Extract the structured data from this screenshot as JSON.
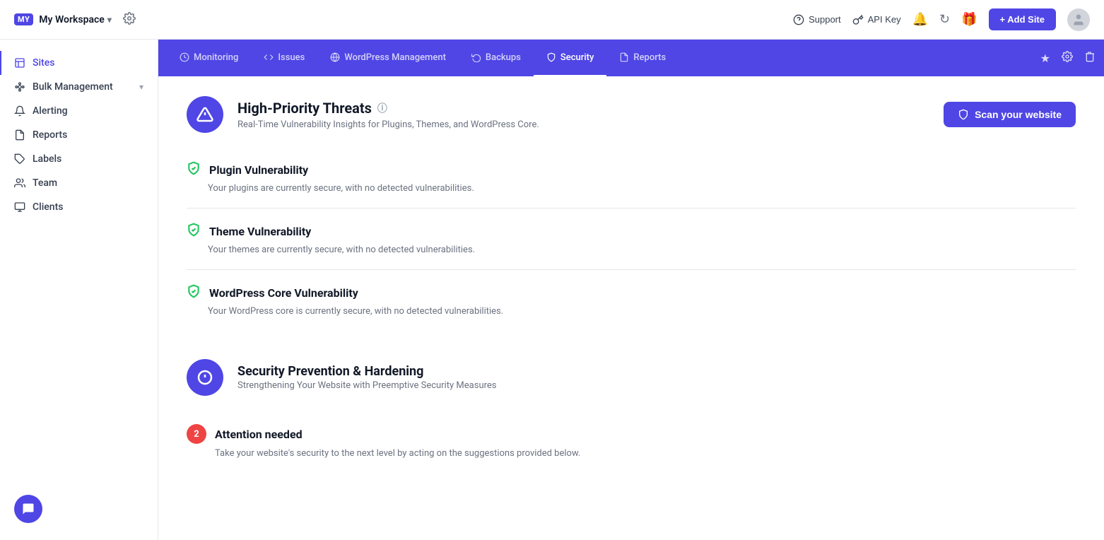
{
  "workspace": {
    "badge": "MY",
    "name": "My Workspace"
  },
  "header": {
    "support_label": "Support",
    "api_key_label": "API Key",
    "add_site_label": "+ Add Site"
  },
  "sidebar": {
    "items": [
      {
        "id": "sites",
        "label": "Sites",
        "active": true
      },
      {
        "id": "bulk-management",
        "label": "Bulk Management",
        "has_expand": true
      },
      {
        "id": "alerting",
        "label": "Alerting"
      },
      {
        "id": "reports",
        "label": "Reports"
      },
      {
        "id": "labels",
        "label": "Labels"
      },
      {
        "id": "team",
        "label": "Team"
      },
      {
        "id": "clients",
        "label": "Clients"
      }
    ]
  },
  "nav_tabs": {
    "tabs": [
      {
        "id": "monitoring",
        "label": "Monitoring",
        "active": false
      },
      {
        "id": "issues",
        "label": "Issues",
        "active": false
      },
      {
        "id": "wordpress-management",
        "label": "WordPress Management",
        "active": false
      },
      {
        "id": "backups",
        "label": "Backups",
        "active": false
      },
      {
        "id": "security",
        "label": "Security",
        "active": true
      },
      {
        "id": "reports",
        "label": "Reports",
        "active": false
      }
    ]
  },
  "security": {
    "high_priority": {
      "title": "High-Priority Threats",
      "description": "Real-Time Vulnerability Insights for Plugins, Themes, and WordPress Core.",
      "scan_button_label": "Scan your website"
    },
    "vulnerabilities": [
      {
        "title": "Plugin Vulnerability",
        "description": "Your plugins are currently secure, with no detected vulnerabilities."
      },
      {
        "title": "Theme Vulnerability",
        "description": "Your themes are currently secure, with no detected vulnerabilities."
      },
      {
        "title": "WordPress Core Vulnerability",
        "description": "Your WordPress core is currently secure, with no detected vulnerabilities."
      }
    ],
    "prevention": {
      "title": "Security Prevention & Hardening",
      "description": "Strengthening Your Website with Preemptive Security Measures"
    },
    "attention": {
      "badge": "2",
      "title": "Attention needed",
      "description": "Take your website's security to the next level by acting on the suggestions provided below."
    }
  }
}
